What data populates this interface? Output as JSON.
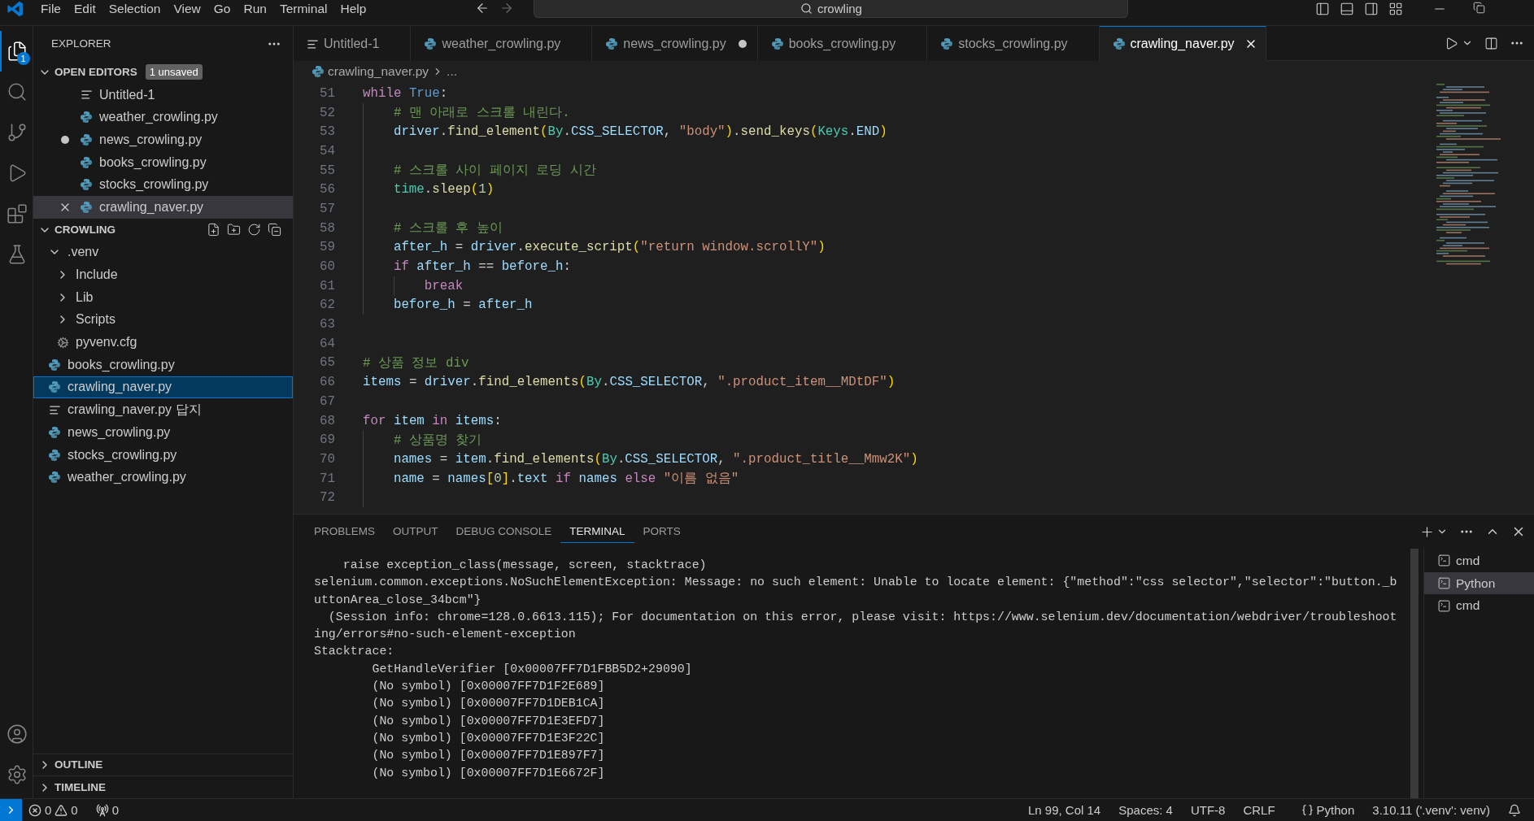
{
  "menu": [
    "File",
    "Edit",
    "Selection",
    "View",
    "Go",
    "Run",
    "Terminal",
    "Help"
  ],
  "title_bar": {
    "search": "crowling"
  },
  "activity_bar": {
    "items": [
      {
        "kind": "explorer",
        "selected": true,
        "badge": "1"
      },
      {
        "kind": "search",
        "selected": false
      },
      {
        "kind": "source_control",
        "selected": false
      },
      {
        "kind": "run",
        "selected": false
      },
      {
        "kind": "extensions",
        "selected": false
      },
      {
        "kind": "testing",
        "selected": false
      }
    ],
    "bottom": [
      {
        "kind": "account"
      },
      {
        "kind": "settings"
      }
    ]
  },
  "sidebar": {
    "title": "EXPLORER",
    "open_editors": {
      "title": "OPEN EDITORS",
      "expanded": true,
      "badge": "1 unsaved",
      "items": [
        {
          "name": "Untitled-1",
          "kind": "text",
          "dirty": false,
          "selected": false
        },
        {
          "name": "weather_crowling.py",
          "kind": "python",
          "dirty": false,
          "selected": false
        },
        {
          "name": "news_crowling.py",
          "kind": "python",
          "dirty": true,
          "selected": false
        },
        {
          "name": "books_crowling.py",
          "kind": "python",
          "dirty": false,
          "selected": false
        },
        {
          "name": "stocks_crowling.py",
          "kind": "python",
          "dirty": false,
          "selected": false
        },
        {
          "name": "crawling_naver.py",
          "kind": "python",
          "dirty": false,
          "selected": true
        }
      ]
    },
    "folder": {
      "title": "CROWLING",
      "expanded": true,
      "items": [
        {
          "name": ".venv",
          "kind": "folder",
          "expanded": true,
          "selected": false,
          "children": [
            {
              "name": "Include",
              "kind": "folder",
              "expanded": false,
              "selected": false
            },
            {
              "name": "Lib",
              "kind": "folder",
              "expanded": false,
              "selected": false
            },
            {
              "name": "Scripts",
              "kind": "folder",
              "expanded": false,
              "selected": false
            },
            {
              "name": "pyvenv.cfg",
              "kind": "config",
              "selected": false
            }
          ]
        },
        {
          "name": "books_crowling.py",
          "kind": "python",
          "selected": false
        },
        {
          "name": "crawling_naver.py",
          "kind": "python",
          "selected": true
        },
        {
          "name": "crawling_naver.py 답지",
          "kind": "text",
          "selected": false
        },
        {
          "name": "news_crowling.py",
          "kind": "python",
          "selected": false
        },
        {
          "name": "stocks_crowling.py",
          "kind": "python",
          "selected": false
        },
        {
          "name": "weather_crowling.py",
          "kind": "python",
          "selected": false
        }
      ]
    },
    "sections": [
      {
        "title": "OUTLINE",
        "expanded": false
      },
      {
        "title": "TIMELINE",
        "expanded": false
      }
    ]
  },
  "tabs": [
    {
      "name": "Untitled-1",
      "kind": "text",
      "dirty": false,
      "selected": false
    },
    {
      "name": "weather_crowling.py",
      "kind": "python",
      "dirty": false,
      "selected": false
    },
    {
      "name": "news_crowling.py",
      "kind": "python",
      "dirty": true,
      "selected": false
    },
    {
      "name": "books_crowling.py",
      "kind": "python",
      "dirty": false,
      "selected": false
    },
    {
      "name": "stocks_crowling.py",
      "kind": "python",
      "dirty": false,
      "selected": false
    },
    {
      "name": "crawling_naver.py",
      "kind": "python",
      "dirty": false,
      "selected": true
    }
  ],
  "breadcrumb": {
    "file": "crawling_naver.py",
    "more": "..."
  },
  "editor": {
    "lines": [
      {
        "number": "51",
        "tokens": [
          {
            "kind": "kw",
            "text": "while "
          },
          {
            "kind": "const",
            "text": "True"
          },
          {
            "kind": "op",
            "text": ":"
          }
        ],
        "children": [
          {
            "number": "52",
            "tokens": [
              {
                "kind": "cm",
                "text": "# 맨 아래로 스크롤 내린다."
              }
            ]
          },
          {
            "number": "53",
            "tokens": [
              {
                "kind": "var",
                "text": "driver"
              },
              {
                "kind": "op",
                "text": "."
              },
              {
                "kind": "fn",
                "text": "find_element"
              },
              {
                "kind": "br",
                "text": "("
              },
              {
                "kind": "cls",
                "text": "By"
              },
              {
                "kind": "op",
                "text": "."
              },
              {
                "kind": "var",
                "text": "CSS_SELECTOR"
              },
              {
                "kind": "op",
                "text": ", "
              },
              {
                "kind": "str",
                "text": "\"body\""
              },
              {
                "kind": "br",
                "text": ")"
              },
              {
                "kind": "op",
                "text": "."
              },
              {
                "kind": "fn",
                "text": "send_keys"
              },
              {
                "kind": "br",
                "text": "("
              },
              {
                "kind": "cls",
                "text": "Keys"
              },
              {
                "kind": "op",
                "text": "."
              },
              {
                "kind": "var",
                "text": "END"
              },
              {
                "kind": "br",
                "text": ")"
              }
            ]
          },
          {
            "number": "54"
          },
          {
            "number": "55",
            "tokens": [
              {
                "kind": "cm",
                "text": "# 스크롤 사이 페이지 로딩 시간"
              }
            ]
          },
          {
            "number": "56",
            "tokens": [
              {
                "kind": "cls",
                "text": "time"
              },
              {
                "kind": "op",
                "text": "."
              },
              {
                "kind": "fn",
                "text": "sleep"
              },
              {
                "kind": "br",
                "text": "("
              },
              {
                "kind": "num",
                "text": "1"
              },
              {
                "kind": "br",
                "text": ")"
              }
            ]
          },
          {
            "number": "57"
          },
          {
            "number": "58",
            "tokens": [
              {
                "kind": "cm",
                "text": "# 스크롤 후 높이"
              }
            ]
          },
          {
            "number": "59",
            "tokens": [
              {
                "kind": "var",
                "text": "after_h"
              },
              {
                "kind": "op",
                "text": " = "
              },
              {
                "kind": "var",
                "text": "driver"
              },
              {
                "kind": "op",
                "text": "."
              },
              {
                "kind": "fn",
                "text": "execute_script"
              },
              {
                "kind": "br",
                "text": "("
              },
              {
                "kind": "str",
                "text": "\"return window.scrollY\""
              },
              {
                "kind": "br",
                "text": ")"
              }
            ]
          },
          {
            "number": "60",
            "tokens": [
              {
                "kind": "kw",
                "text": "if "
              },
              {
                "kind": "var",
                "text": "after_h"
              },
              {
                "kind": "op",
                "text": " == "
              },
              {
                "kind": "var",
                "text": "before_h"
              },
              {
                "kind": "op",
                "text": ":"
              }
            ],
            "children": [
              {
                "number": "61",
                "tokens": [
                  {
                    "kind": "kw",
                    "text": "break"
                  }
                ]
              }
            ]
          },
          {
            "number": "62",
            "tokens": [
              {
                "kind": "var",
                "text": "before_h"
              },
              {
                "kind": "op",
                "text": " = "
              },
              {
                "kind": "var",
                "text": "after_h"
              }
            ]
          }
        ]
      },
      {
        "number": "63"
      },
      {
        "number": "64"
      },
      {
        "number": "65",
        "tokens": [
          {
            "kind": "cm",
            "text": "# 상품 정보 div"
          }
        ]
      },
      {
        "number": "66",
        "tokens": [
          {
            "kind": "var",
            "text": "items"
          },
          {
            "kind": "op",
            "text": " = "
          },
          {
            "kind": "var",
            "text": "driver"
          },
          {
            "kind": "op",
            "text": "."
          },
          {
            "kind": "fn",
            "text": "find_elements"
          },
          {
            "kind": "br",
            "text": "("
          },
          {
            "kind": "cls",
            "text": "By"
          },
          {
            "kind": "op",
            "text": "."
          },
          {
            "kind": "var",
            "text": "CSS_SELECTOR"
          },
          {
            "kind": "op",
            "text": ", "
          },
          {
            "kind": "str",
            "text": "\".product_item__MDtDF\""
          },
          {
            "kind": "br",
            "text": ")"
          }
        ]
      },
      {
        "number": "67"
      },
      {
        "number": "68",
        "tokens": [
          {
            "kind": "kw",
            "text": "for "
          },
          {
            "kind": "var",
            "text": "item "
          },
          {
            "kind": "kw",
            "text": "in "
          },
          {
            "kind": "var",
            "text": "items"
          },
          {
            "kind": "op",
            "text": ":"
          }
        ],
        "children": [
          {
            "number": "69",
            "tokens": [
              {
                "kind": "cm",
                "text": "# 상품명 찾기"
              }
            ]
          },
          {
            "number": "70",
            "tokens": [
              {
                "kind": "var",
                "text": "names"
              },
              {
                "kind": "op",
                "text": " = "
              },
              {
                "kind": "var",
                "text": "item"
              },
              {
                "kind": "op",
                "text": "."
              },
              {
                "kind": "fn",
                "text": "find_elements"
              },
              {
                "kind": "br",
                "text": "("
              },
              {
                "kind": "cls",
                "text": "By"
              },
              {
                "kind": "op",
                "text": "."
              },
              {
                "kind": "var",
                "text": "CSS_SELECTOR"
              },
              {
                "kind": "op",
                "text": ", "
              },
              {
                "kind": "str",
                "text": "\".product_title__Mmw2K\""
              },
              {
                "kind": "br",
                "text": ")"
              }
            ]
          },
          {
            "number": "71",
            "tokens": [
              {
                "kind": "var",
                "text": "name"
              },
              {
                "kind": "op",
                "text": " = "
              },
              {
                "kind": "var",
                "text": "names"
              },
              {
                "kind": "br",
                "text": "["
              },
              {
                "kind": "num",
                "text": "0"
              },
              {
                "kind": "br",
                "text": "]"
              },
              {
                "kind": "op",
                "text": "."
              },
              {
                "kind": "var",
                "text": "text "
              },
              {
                "kind": "kw",
                "text": "if "
              },
              {
                "kind": "var",
                "text": "names "
              },
              {
                "kind": "kw",
                "text": "else "
              },
              {
                "kind": "str",
                "text": "\"이름 없음\""
              }
            ]
          },
          {
            "number": "72"
          }
        ]
      }
    ]
  },
  "panel": {
    "tabs": [
      {
        "label": "PROBLEMS",
        "selected": false
      },
      {
        "label": "OUTPUT",
        "selected": false
      },
      {
        "label": "DEBUG CONSOLE",
        "selected": false
      },
      {
        "label": "TERMINAL",
        "selected": true
      },
      {
        "label": "PORTS",
        "selected": false
      }
    ],
    "terminal_lines": [
      "    raise exception_class(message, screen, stacktrace)",
      "selenium.common.exceptions.NoSuchElementException: Message: no such element: Unable to locate element: {\"method\":\"css selector\",\"selector\":\"button._b",
      "uttonArea_close_34bcm\"}",
      "  (Session info: chrome=128.0.6613.115); For documentation on this error, please visit: https://www.selenium.dev/documentation/webdriver/troubleshoot",
      "ing/errors#no-such-element-exception",
      "Stacktrace:",
      "        GetHandleVerifier [0x00007FF7D1FBB5D2+29090]",
      "        (No symbol) [0x00007FF7D1F2E689]",
      "        (No symbol) [0x00007FF7D1DEB1CA]",
      "        (No symbol) [0x00007FF7D1E3EFD7]",
      "        (No symbol) [0x00007FF7D1E3F22C]",
      "        (No symbol) [0x00007FF7D1E897F7]",
      "        (No symbol) [0x00007FF7D1E6672F]"
    ],
    "terminals": [
      {
        "name": "cmd",
        "selected": false
      },
      {
        "name": "Python",
        "selected": true
      },
      {
        "name": "cmd",
        "selected": false
      }
    ]
  },
  "status_bar": {
    "errors": "0",
    "warnings": "0",
    "ports": "0",
    "items": [
      "Ln 99, Col 14",
      "Spaces: 4",
      "UTF-8",
      "CRLF"
    ],
    "language": "Python",
    "interpreter": "3.10.11 ('.venv': venv)"
  }
}
